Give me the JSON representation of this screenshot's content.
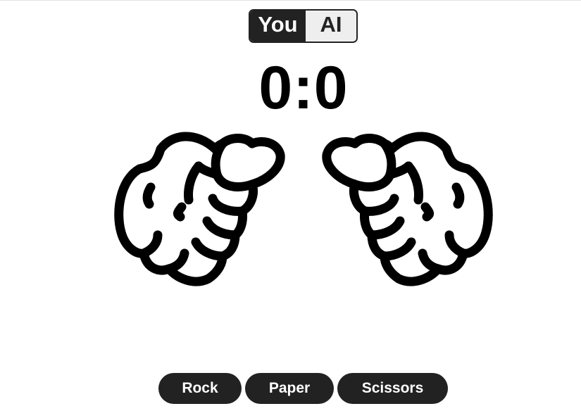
{
  "players": {
    "you_label": "You",
    "ai_label": "AI",
    "active": "You"
  },
  "score": {
    "display": "0:0",
    "you": 0,
    "ai": 0
  },
  "hands": {
    "player_hand_icon": "fist-icon",
    "ai_hand_icon": "fist-icon"
  },
  "controls": {
    "rock_label": "Rock",
    "paper_label": "Paper",
    "scissors_label": "Scissors"
  },
  "colors": {
    "dark": "#222222",
    "light": "#eeeeee",
    "text_on_dark": "#ffffff"
  }
}
